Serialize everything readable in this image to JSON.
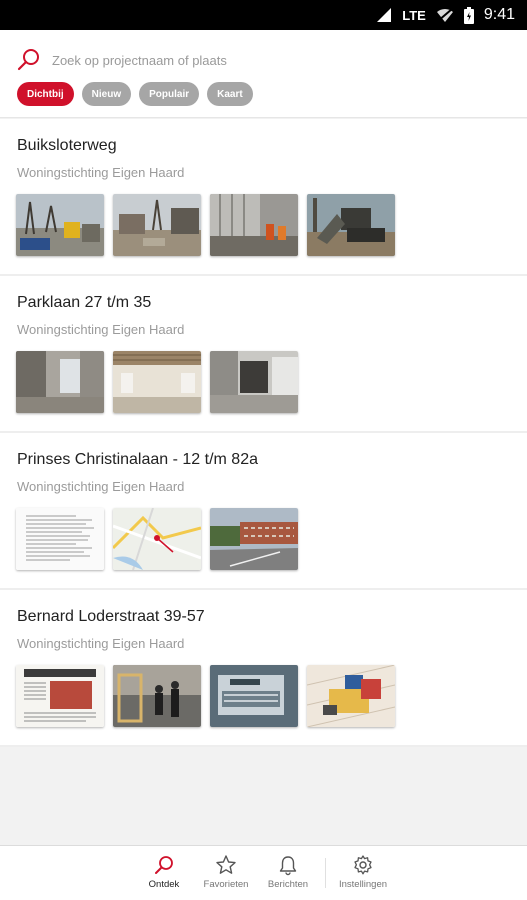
{
  "status_bar": {
    "network": "LTE",
    "time": "9:41"
  },
  "search": {
    "placeholder": "Zoek op projectnaam of plaats"
  },
  "filters": [
    {
      "label": "Dichtbij",
      "active": true
    },
    {
      "label": "Nieuw",
      "active": false
    },
    {
      "label": "Populair",
      "active": false
    },
    {
      "label": "Kaart",
      "active": false
    }
  ],
  "projects": [
    {
      "title": "Buiksloterweg",
      "owner": "Woningstichting Eigen Haard",
      "thumbnails": [
        "construction-site-photo",
        "construction-site-photo",
        "construction-site-photo",
        "excavator-photo"
      ]
    },
    {
      "title": "Parklaan 27 t/m 35",
      "owner": "Woningstichting Eigen Haard",
      "thumbnails": [
        "interior-photo",
        "interior-photo",
        "interior-photo"
      ]
    },
    {
      "title": "Prinses Christinalaan - 12 t/m 82a",
      "owner": "Woningstichting Eigen Haard",
      "thumbnails": [
        "document-photo",
        "map-photo",
        "street-photo"
      ]
    },
    {
      "title": "Bernard Loderstraat 39-57",
      "owner": "Woningstichting Eigen Haard",
      "thumbnails": [
        "newspaper-photo",
        "people-photo",
        "billboard-photo",
        "model-photo"
      ]
    }
  ],
  "bottom_nav": [
    {
      "label": "Ontdek",
      "icon": "search-icon",
      "active": true
    },
    {
      "label": "Favorieten",
      "icon": "star-icon",
      "active": false
    },
    {
      "label": "Berichten",
      "icon": "bell-icon",
      "active": false
    },
    {
      "label": "Instellingen",
      "icon": "gear-icon",
      "active": false
    }
  ],
  "colors": {
    "accent": "#d0112b",
    "chip_inactive": "#a6a6a6"
  }
}
